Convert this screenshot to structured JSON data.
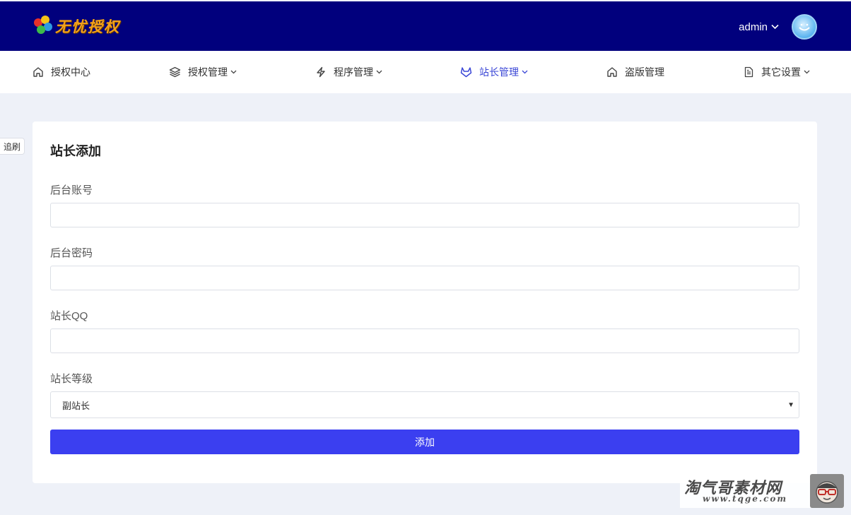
{
  "header": {
    "logo_text": "无忧授权",
    "user_name": "admin"
  },
  "nav": {
    "items": [
      {
        "label": "授权中心",
        "icon": "home-icon",
        "dropdown": false,
        "active": false
      },
      {
        "label": "授权管理",
        "icon": "layers-icon",
        "dropdown": true,
        "active": false
      },
      {
        "label": "程序管理",
        "icon": "lightning-icon",
        "dropdown": true,
        "active": false
      },
      {
        "label": "站长管理",
        "icon": "gitlab-icon",
        "dropdown": true,
        "active": true
      },
      {
        "label": "盗版管理",
        "icon": "home-icon",
        "dropdown": false,
        "active": false
      },
      {
        "label": "其它设置",
        "icon": "document-icon",
        "dropdown": true,
        "active": false
      }
    ],
    "active_color": "#3b47d6"
  },
  "side_tab": {
    "label": "追刷"
  },
  "form": {
    "title": "站长添加",
    "fields": [
      {
        "label": "后台账号",
        "value": ""
      },
      {
        "label": "后台密码",
        "value": ""
      },
      {
        "label": "站长QQ",
        "value": ""
      }
    ],
    "level": {
      "label": "站长等级",
      "selected": "副站长"
    },
    "submit_label": "添加",
    "submit_color": "#3b3ff0"
  },
  "watermark": {
    "title": "淘气哥素材网",
    "url": "www.tqge.com"
  },
  "colors": {
    "header_bg": "#01007d",
    "page_bg": "#eef1f8"
  }
}
